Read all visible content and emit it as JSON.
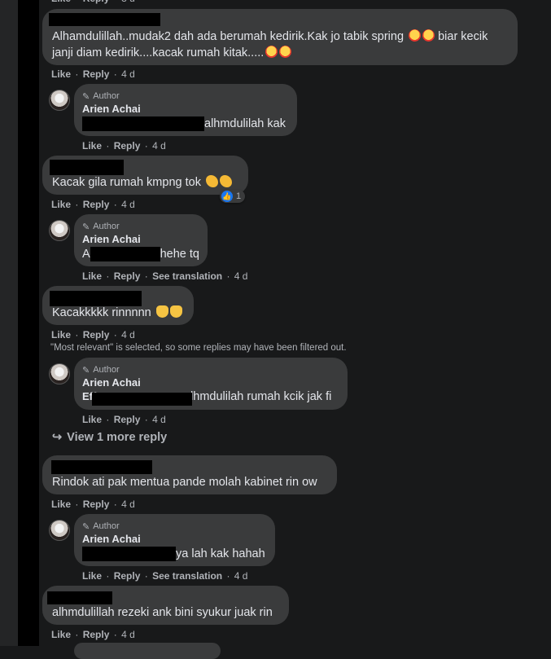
{
  "actions": {
    "like": "Like",
    "reply": "Reply",
    "see_translation": "See translation",
    "separator": "·"
  },
  "top_partial": {
    "time": "3 d"
  },
  "comments": [
    {
      "author_redacted": true,
      "line1": "Alhamdulillah..mudak2 dah ada berumah kedirik.Kak jo tabik spring",
      "line1_tail": "biar kecik",
      "line2": "janji diam kedirik....kacak rumah kitak.....",
      "time": "4 d"
    },
    {
      "author_redacted": true,
      "text": "Kacak gila rumah kmpng tok",
      "time": "4 d",
      "reaction_count": "1"
    },
    {
      "author_redacted": true,
      "text": "Kacakkkkk rinnnnn",
      "time": "4 d"
    },
    {
      "author_redacted": true,
      "text": "Rindok ati pak mentua pande molah kabinet rin ow",
      "time": "4 d"
    },
    {
      "author_redacted": true,
      "text": "alhmdulillah rezeki ank bini syukur juak rin",
      "time": "4 d"
    }
  ],
  "replies": [
    {
      "badge": "Author",
      "name": "Arien Achai",
      "text": "alhmdulilah kak",
      "time": "4 d",
      "translation": false
    },
    {
      "badge": "Author",
      "name": "Arien Achai",
      "prefix": "A",
      "text": "hehe tq",
      "time": "4 d",
      "translation": true
    },
    {
      "badge": "Author",
      "name": "Arien Achai",
      "prefix": "Eff",
      "prefix2": "A",
      "text": "alhmdulilah rumah kcik jak fi",
      "time": "4 d",
      "translation": false
    },
    {
      "badge": "Author",
      "name": "Arien Achai",
      "text": "ya lah kak hahah",
      "time": "4 d",
      "translation": true
    }
  ],
  "notice": "\"Most relevant\" is selected, so some replies may have been filtered out.",
  "view_more": "View 1 more reply",
  "icons": {
    "pencil": "pencil-icon",
    "reply_arrow": "reply-arrow-icon",
    "like_reaction": "like-reaction-icon"
  }
}
